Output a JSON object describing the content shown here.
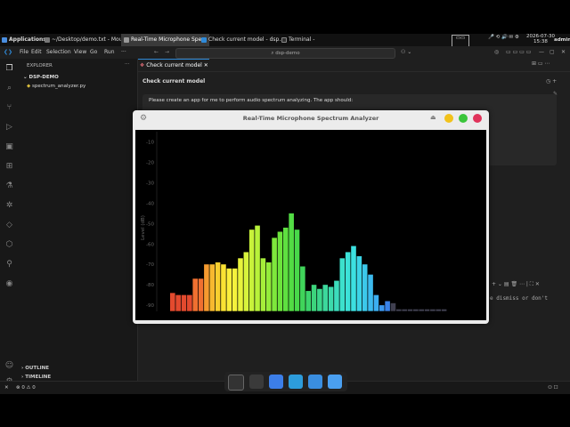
{
  "taskbar": {
    "applications": "Applications",
    "items": [
      "~/Desktop/demo.txt - Mou...",
      "Real-Time Microphone Spe...",
      "Check current model - dsp...",
      "Terminal -"
    ],
    "date": "2026-07-30",
    "time": "15:38",
    "user": "admin"
  },
  "vscode": {
    "menu": [
      "File",
      "Edit",
      "Selection",
      "View",
      "Go",
      "Run",
      "···"
    ],
    "command_center": "dsp-demo",
    "explorer_title": "EXPLORER",
    "folder": "DSP-DEMO",
    "file": "spectrum_analyzer.py",
    "outline": "OUTLINE",
    "timeline": "TIMELINE",
    "tab": "Check current model",
    "chat_header": "Check current model",
    "prompt": "Please create an app for me to perform audio spectrum analyzing. The app should:",
    "hint_text": "e dismiss or don't",
    "status_left": "⊗ 0 ⚠ 0"
  },
  "app": {
    "title": "Real-Time Microphone Spectrum Analyzer",
    "ylabel": "Level (dB)",
    "yticks": [
      "-10",
      "-20",
      "-30",
      "-40",
      "-50",
      "-60",
      "-70",
      "-80",
      "-90"
    ]
  },
  "chart_data": {
    "type": "bar",
    "ylabel": "Level (dB)",
    "ylim": [
      -93,
      -5
    ],
    "values": [
      -84,
      -85,
      -85,
      -85,
      -77,
      -77,
      -70,
      -70,
      -69,
      -70,
      -72,
      -72,
      -67,
      -64,
      -53,
      -51,
      -67,
      -69,
      -57,
      -54,
      -52,
      -45,
      -53,
      -71,
      -83,
      -80,
      -82,
      -80,
      -81,
      -78,
      -67,
      -64,
      -61,
      -66,
      -70,
      -75,
      -85,
      -90,
      -88,
      -89,
      -92,
      -92,
      -92,
      -92,
      -92,
      -92,
      -92,
      -92,
      -92
    ],
    "colors": [
      "#e34a2e",
      "#e34a2e",
      "#e34a2e",
      "#e34a2e",
      "#f07030",
      "#f07030",
      "#f59a2f",
      "#f7b82f",
      "#f8cf2f",
      "#fae233",
      "#fbef3c",
      "#f5f23c",
      "#e8f33c",
      "#d8f33c",
      "#c8f23a",
      "#b8f23a",
      "#a6ee3a",
      "#94ec3a",
      "#7ee83c",
      "#6ce43c",
      "#5ee040",
      "#52dc44",
      "#48d84a",
      "#40d45a",
      "#3cd46c",
      "#3cd47c",
      "#3cd68c",
      "#3cd89c",
      "#3cdaac",
      "#3cdcbc",
      "#3ce0cc",
      "#3ce2d8",
      "#3ce0e0",
      "#3cd4e6",
      "#3cc8ea",
      "#3cbaee",
      "#3caef0",
      "#3c98f0",
      "#3a82e8",
      "#404050",
      "#404050",
      "#404050",
      "#404050",
      "#404050",
      "#404050",
      "#404050",
      "#404050",
      "#404050",
      "#404050"
    ]
  }
}
